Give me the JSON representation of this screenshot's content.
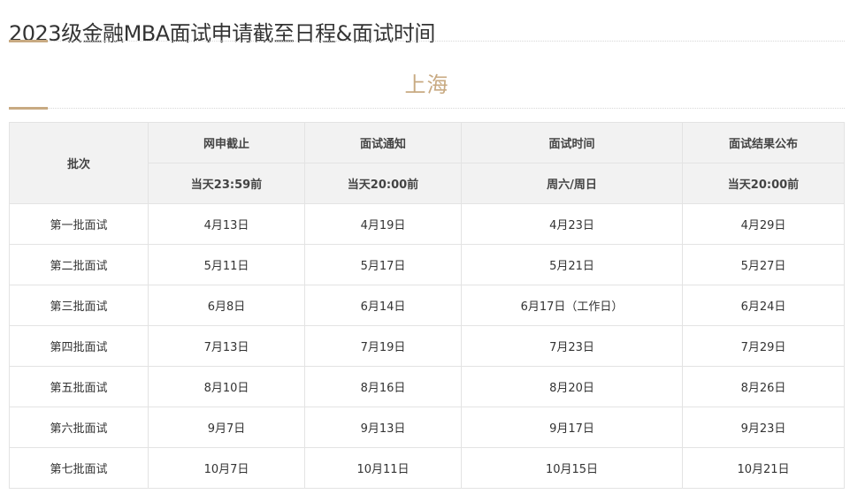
{
  "page": {
    "title": "2023级金融MBA面试申请截至日程&面试时间",
    "section_title": "上海"
  },
  "table": {
    "batch_header": "批次",
    "columns": [
      {
        "label": "网申截止",
        "sub": "当天23:59前"
      },
      {
        "label": "面试通知",
        "sub": "当天20:00前"
      },
      {
        "label": "面试时间",
        "sub": "周六/周日"
      },
      {
        "label": "面试结果公布",
        "sub": "当天20:00前"
      }
    ],
    "rows": [
      {
        "batch": "第一批面试",
        "deadline": "4月13日",
        "notice": "4月19日",
        "interview": "4月23日",
        "result": "4月29日"
      },
      {
        "batch": "第二批面试",
        "deadline": "5月11日",
        "notice": "5月17日",
        "interview": "5月21日",
        "result": "5月27日"
      },
      {
        "batch": "第三批面试",
        "deadline": "6月8日",
        "notice": "6月14日",
        "interview": "6月17日（工作日）",
        "result": "6月24日"
      },
      {
        "batch": "第四批面试",
        "deadline": "7月13日",
        "notice": "7月19日",
        "interview": "7月23日",
        "result": "7月29日"
      },
      {
        "batch": "第五批面试",
        "deadline": "8月10日",
        "notice": "8月16日",
        "interview": "8月20日",
        "result": "8月26日"
      },
      {
        "batch": "第六批面试",
        "deadline": "9月7日",
        "notice": "9月13日",
        "interview": "9月17日",
        "result": "9月23日"
      },
      {
        "batch": "第七批面试",
        "deadline": "10月7日",
        "notice": "10月11日",
        "interview": "10月15日",
        "result": "10月21日"
      }
    ]
  },
  "colors": {
    "accent": "#c8aa82",
    "header_bg": "#f2f2f2",
    "border": "#e3e3e3",
    "text": "#333333"
  }
}
